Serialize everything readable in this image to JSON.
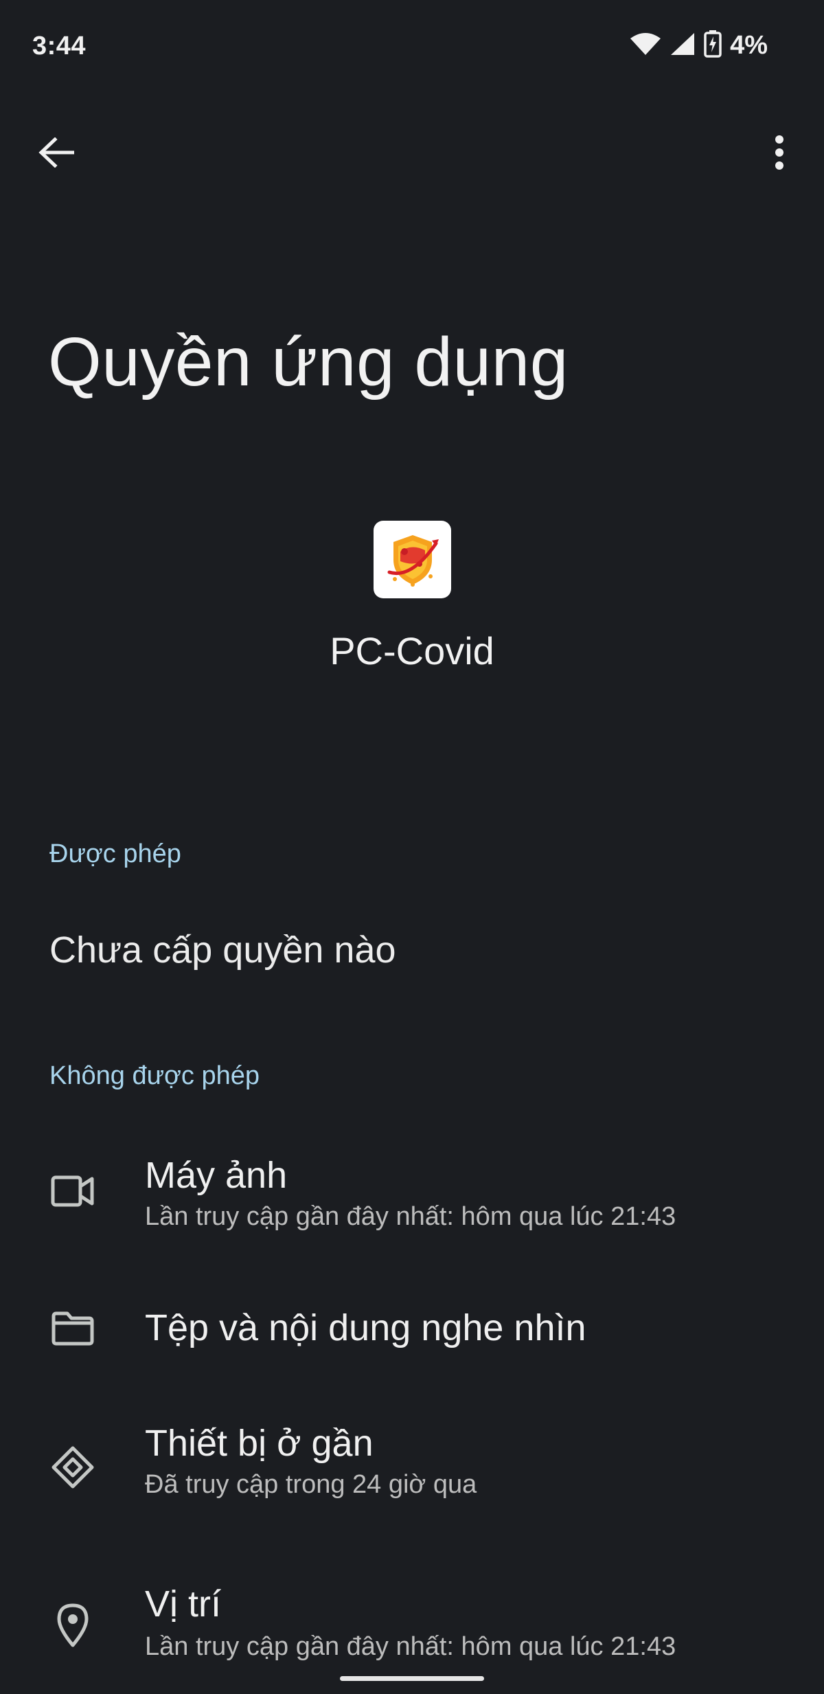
{
  "status_bar": {
    "time": "3:44",
    "battery_percent": "4%"
  },
  "toolbar": {
    "back_icon": "arrow-back-icon",
    "menu_icon": "more-vert-icon"
  },
  "page": {
    "title": "Quyền ứng dụng"
  },
  "app": {
    "name": "PC-Covid"
  },
  "allowed": {
    "header": "Được phép",
    "empty_text": "Chưa cấp quyền nào"
  },
  "denied": {
    "header": "Không được phép",
    "items": [
      {
        "icon": "videocam-icon",
        "title": "Máy ảnh",
        "subtitle": "Lần truy cập gần đây nhất: hôm qua lúc 21:43"
      },
      {
        "icon": "folder-icon",
        "title": "Tệp và nội dung nghe nhìn",
        "subtitle": ""
      },
      {
        "icon": "nearby-devices-icon",
        "title": "Thiết bị ở gần",
        "subtitle": "Đã truy cập trong 24 giờ qua"
      },
      {
        "icon": "location-pin-icon",
        "title": "Vị trí",
        "subtitle": "Lần truy cập gần đây nhất: hôm qua lúc 21:43"
      }
    ]
  },
  "colors": {
    "background": "#1b1d21",
    "section_header": "#a8d4ec",
    "text_primary": "#f0f0f0",
    "text_secondary": "#bdbdbd"
  }
}
